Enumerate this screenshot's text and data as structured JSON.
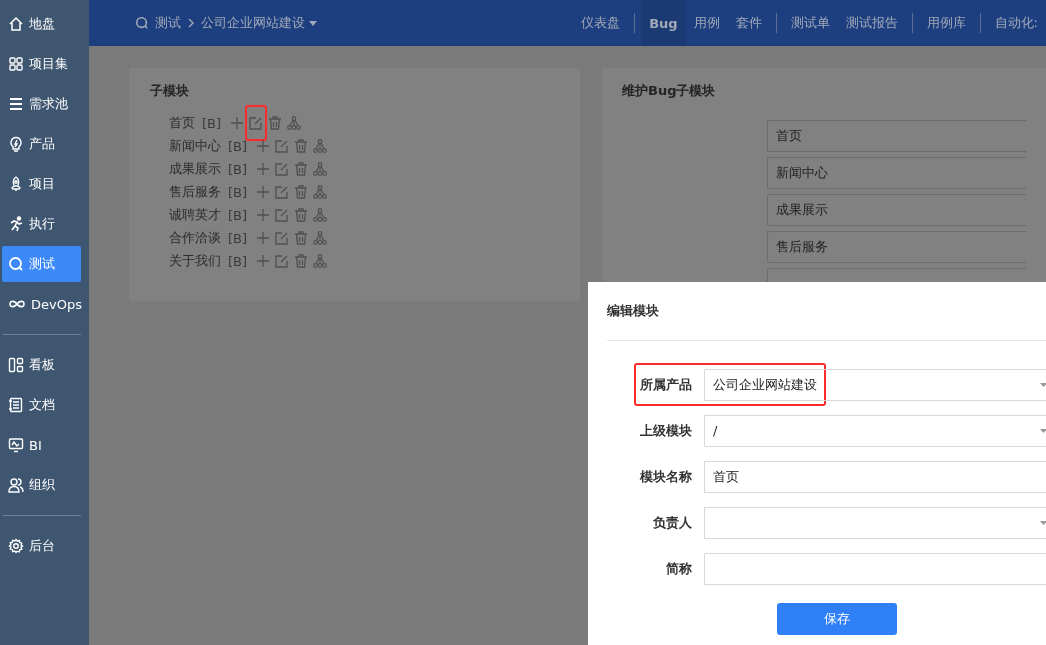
{
  "sidebar": {
    "groups": [
      {
        "items": [
          {
            "label": "地盘",
            "selected": false
          },
          {
            "label": "项目集",
            "selected": false
          },
          {
            "label": "需求池",
            "selected": false
          },
          {
            "label": "产品",
            "selected": false
          },
          {
            "label": "项目",
            "selected": false
          },
          {
            "label": "执行",
            "selected": false
          },
          {
            "label": "测试",
            "selected": true
          },
          {
            "label": "DevOps",
            "selected": false
          }
        ]
      },
      {
        "items": [
          {
            "label": "看板",
            "selected": false
          },
          {
            "label": "文档",
            "selected": false
          },
          {
            "label": "BI",
            "selected": false
          },
          {
            "label": "组织",
            "selected": false
          }
        ]
      },
      {
        "items": [
          {
            "label": "后台",
            "selected": false
          }
        ]
      }
    ]
  },
  "breadcrumb": {
    "section": "测试",
    "product": "公司企业网站建设"
  },
  "nav": {
    "groups": [
      {
        "items": [
          {
            "label": "仪表盘",
            "selected": false
          }
        ]
      },
      {
        "items": [
          {
            "label": "Bug",
            "selected": true
          },
          {
            "label": "用例",
            "selected": false
          },
          {
            "label": "套件",
            "selected": false
          }
        ]
      },
      {
        "items": [
          {
            "label": "测试单",
            "selected": false
          },
          {
            "label": "测试报告",
            "selected": false
          }
        ]
      },
      {
        "items": [
          {
            "label": "用例库",
            "selected": false
          }
        ]
      },
      {
        "items": [
          {
            "label": "自动化:",
            "selected": false
          }
        ]
      }
    ]
  },
  "submodules": {
    "title": "子模块",
    "rows": [
      {
        "name": "首页",
        "tag": "[B]",
        "highlighted": true
      },
      {
        "name": "新闻中心",
        "tag": "[B]",
        "highlighted": false
      },
      {
        "name": "成果展示",
        "tag": "[B]",
        "highlighted": false
      },
      {
        "name": "售后服务",
        "tag": "[B]",
        "highlighted": false
      },
      {
        "name": "诚聘英才",
        "tag": "[B]",
        "highlighted": false
      },
      {
        "name": "合作洽谈",
        "tag": "[B]",
        "highlighted": false
      },
      {
        "name": "关于我们",
        "tag": "[B]",
        "highlighted": false
      }
    ]
  },
  "maintain": {
    "title": "维护Bug子模块",
    "fields": [
      "首页",
      "新闻中心",
      "成果展示",
      "售后服务"
    ]
  },
  "dialog": {
    "title": "编辑模块",
    "fields": [
      {
        "kind": "select",
        "label": "所属产品",
        "value": "公司企业网站建设",
        "highlighted": true
      },
      {
        "kind": "select",
        "label": "上级模块",
        "value": "/",
        "highlighted": false
      },
      {
        "kind": "text",
        "label": "模块名称",
        "value": "首页",
        "highlighted": false
      },
      {
        "kind": "select",
        "label": "负责人",
        "highlighted": false
      },
      {
        "kind": "text",
        "label": "简称",
        "highlighted": false
      }
    ],
    "save": "保存"
  }
}
